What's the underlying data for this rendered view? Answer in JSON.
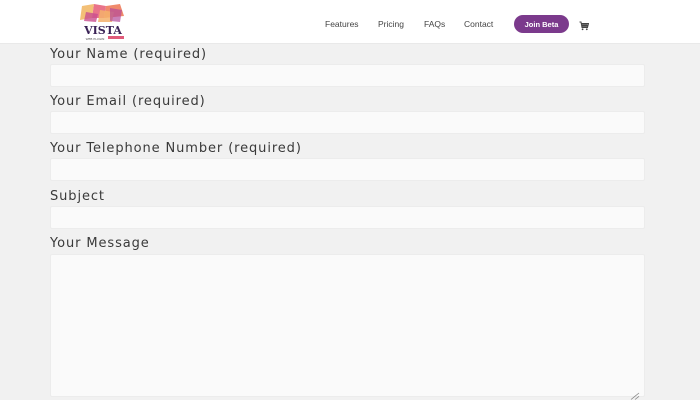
{
  "logo": {
    "text": "VISTA",
    "tagline": "WEB PLUGIN"
  },
  "nav": {
    "items": [
      "Features",
      "Pricing",
      "FAQs",
      "Contact"
    ],
    "cta_label": "Join Beta",
    "cart_icon": "cart-icon"
  },
  "form": {
    "name_label": "Your Name (required)",
    "name_value": "",
    "email_label": "Your Email (required)",
    "email_value": "",
    "phone_label": "Your Telephone Number (required)",
    "phone_value": "",
    "subject_label": "Subject",
    "subject_value": "",
    "message_label": "Your Message",
    "message_value": ""
  },
  "colors": {
    "accent": "#7b3a8c",
    "page_bg": "#f1f1f1",
    "field_bg": "#fafafa"
  }
}
